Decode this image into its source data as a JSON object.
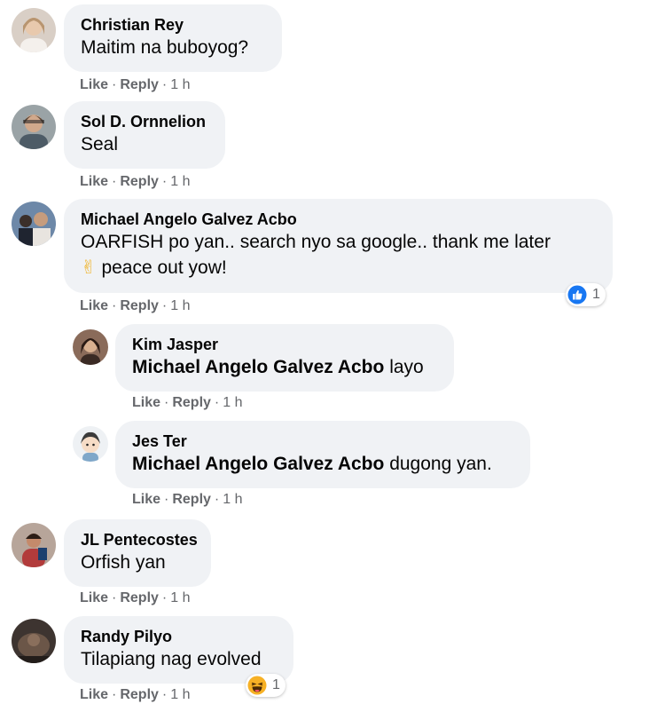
{
  "actions": {
    "like": "Like",
    "reply": "Reply",
    "separator": "·"
  },
  "comments": [
    {
      "author": "Christian Rey",
      "text": "Maitim na buboyog?",
      "time": "1 h"
    },
    {
      "author": "Sol D. Ornnelion",
      "text": "Seal",
      "time": "1 h"
    },
    {
      "author": "Michael Angelo Galvez Acbo",
      "text_line1": "OARFISH po yan.. search nyo sa google.. thank me later",
      "text_line2_emoji": "✌",
      "text_line2": "peace out yow!",
      "time": "1 h",
      "reaction": {
        "icon": "like-reaction-icon",
        "count": "1",
        "color": "#1877f2"
      }
    },
    {
      "author": "Kim Jasper",
      "mention": "Michael Angelo Galvez Acbo",
      "text": "layo",
      "time": "1 h"
    },
    {
      "author": "Jes Ter",
      "mention": "Michael Angelo Galvez Acbo",
      "text": "dugong yan.",
      "time": "1 h"
    },
    {
      "author": "JL Pentecostes",
      "text": "Orfish yan",
      "time": "1 h"
    },
    {
      "author": "Randy Pilyo",
      "text": "Tilapiang nag evolved",
      "time": "1 h",
      "reaction": {
        "icon": "haha-reaction-icon",
        "count": "1",
        "color": "#f7b125"
      }
    }
  ]
}
